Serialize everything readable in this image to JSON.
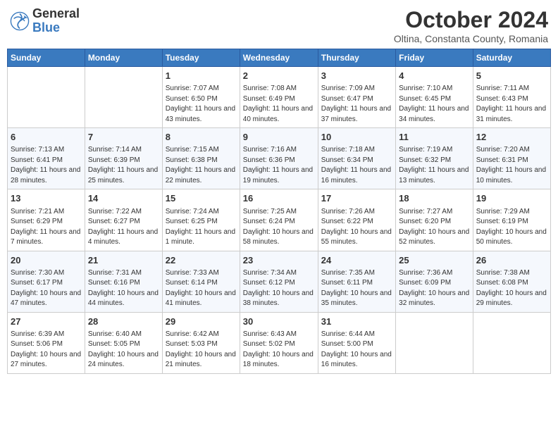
{
  "header": {
    "logo_general": "General",
    "logo_blue": "Blue",
    "month_title": "October 2024",
    "location": "Oltina, Constanta County, Romania"
  },
  "days_of_week": [
    "Sunday",
    "Monday",
    "Tuesday",
    "Wednesday",
    "Thursday",
    "Friday",
    "Saturday"
  ],
  "weeks": [
    [
      {
        "day": "",
        "info": ""
      },
      {
        "day": "",
        "info": ""
      },
      {
        "day": "1",
        "info": "Sunrise: 7:07 AM\nSunset: 6:50 PM\nDaylight: 11 hours and 43 minutes."
      },
      {
        "day": "2",
        "info": "Sunrise: 7:08 AM\nSunset: 6:49 PM\nDaylight: 11 hours and 40 minutes."
      },
      {
        "day": "3",
        "info": "Sunrise: 7:09 AM\nSunset: 6:47 PM\nDaylight: 11 hours and 37 minutes."
      },
      {
        "day": "4",
        "info": "Sunrise: 7:10 AM\nSunset: 6:45 PM\nDaylight: 11 hours and 34 minutes."
      },
      {
        "day": "5",
        "info": "Sunrise: 7:11 AM\nSunset: 6:43 PM\nDaylight: 11 hours and 31 minutes."
      }
    ],
    [
      {
        "day": "6",
        "info": "Sunrise: 7:13 AM\nSunset: 6:41 PM\nDaylight: 11 hours and 28 minutes."
      },
      {
        "day": "7",
        "info": "Sunrise: 7:14 AM\nSunset: 6:39 PM\nDaylight: 11 hours and 25 minutes."
      },
      {
        "day": "8",
        "info": "Sunrise: 7:15 AM\nSunset: 6:38 PM\nDaylight: 11 hours and 22 minutes."
      },
      {
        "day": "9",
        "info": "Sunrise: 7:16 AM\nSunset: 6:36 PM\nDaylight: 11 hours and 19 minutes."
      },
      {
        "day": "10",
        "info": "Sunrise: 7:18 AM\nSunset: 6:34 PM\nDaylight: 11 hours and 16 minutes."
      },
      {
        "day": "11",
        "info": "Sunrise: 7:19 AM\nSunset: 6:32 PM\nDaylight: 11 hours and 13 minutes."
      },
      {
        "day": "12",
        "info": "Sunrise: 7:20 AM\nSunset: 6:31 PM\nDaylight: 11 hours and 10 minutes."
      }
    ],
    [
      {
        "day": "13",
        "info": "Sunrise: 7:21 AM\nSunset: 6:29 PM\nDaylight: 11 hours and 7 minutes."
      },
      {
        "day": "14",
        "info": "Sunrise: 7:22 AM\nSunset: 6:27 PM\nDaylight: 11 hours and 4 minutes."
      },
      {
        "day": "15",
        "info": "Sunrise: 7:24 AM\nSunset: 6:25 PM\nDaylight: 11 hours and 1 minute."
      },
      {
        "day": "16",
        "info": "Sunrise: 7:25 AM\nSunset: 6:24 PM\nDaylight: 10 hours and 58 minutes."
      },
      {
        "day": "17",
        "info": "Sunrise: 7:26 AM\nSunset: 6:22 PM\nDaylight: 10 hours and 55 minutes."
      },
      {
        "day": "18",
        "info": "Sunrise: 7:27 AM\nSunset: 6:20 PM\nDaylight: 10 hours and 52 minutes."
      },
      {
        "day": "19",
        "info": "Sunrise: 7:29 AM\nSunset: 6:19 PM\nDaylight: 10 hours and 50 minutes."
      }
    ],
    [
      {
        "day": "20",
        "info": "Sunrise: 7:30 AM\nSunset: 6:17 PM\nDaylight: 10 hours and 47 minutes."
      },
      {
        "day": "21",
        "info": "Sunrise: 7:31 AM\nSunset: 6:16 PM\nDaylight: 10 hours and 44 minutes."
      },
      {
        "day": "22",
        "info": "Sunrise: 7:33 AM\nSunset: 6:14 PM\nDaylight: 10 hours and 41 minutes."
      },
      {
        "day": "23",
        "info": "Sunrise: 7:34 AM\nSunset: 6:12 PM\nDaylight: 10 hours and 38 minutes."
      },
      {
        "day": "24",
        "info": "Sunrise: 7:35 AM\nSunset: 6:11 PM\nDaylight: 10 hours and 35 minutes."
      },
      {
        "day": "25",
        "info": "Sunrise: 7:36 AM\nSunset: 6:09 PM\nDaylight: 10 hours and 32 minutes."
      },
      {
        "day": "26",
        "info": "Sunrise: 7:38 AM\nSunset: 6:08 PM\nDaylight: 10 hours and 29 minutes."
      }
    ],
    [
      {
        "day": "27",
        "info": "Sunrise: 6:39 AM\nSunset: 5:06 PM\nDaylight: 10 hours and 27 minutes."
      },
      {
        "day": "28",
        "info": "Sunrise: 6:40 AM\nSunset: 5:05 PM\nDaylight: 10 hours and 24 minutes."
      },
      {
        "day": "29",
        "info": "Sunrise: 6:42 AM\nSunset: 5:03 PM\nDaylight: 10 hours and 21 minutes."
      },
      {
        "day": "30",
        "info": "Sunrise: 6:43 AM\nSunset: 5:02 PM\nDaylight: 10 hours and 18 minutes."
      },
      {
        "day": "31",
        "info": "Sunrise: 6:44 AM\nSunset: 5:00 PM\nDaylight: 10 hours and 16 minutes."
      },
      {
        "day": "",
        "info": ""
      },
      {
        "day": "",
        "info": ""
      }
    ]
  ]
}
